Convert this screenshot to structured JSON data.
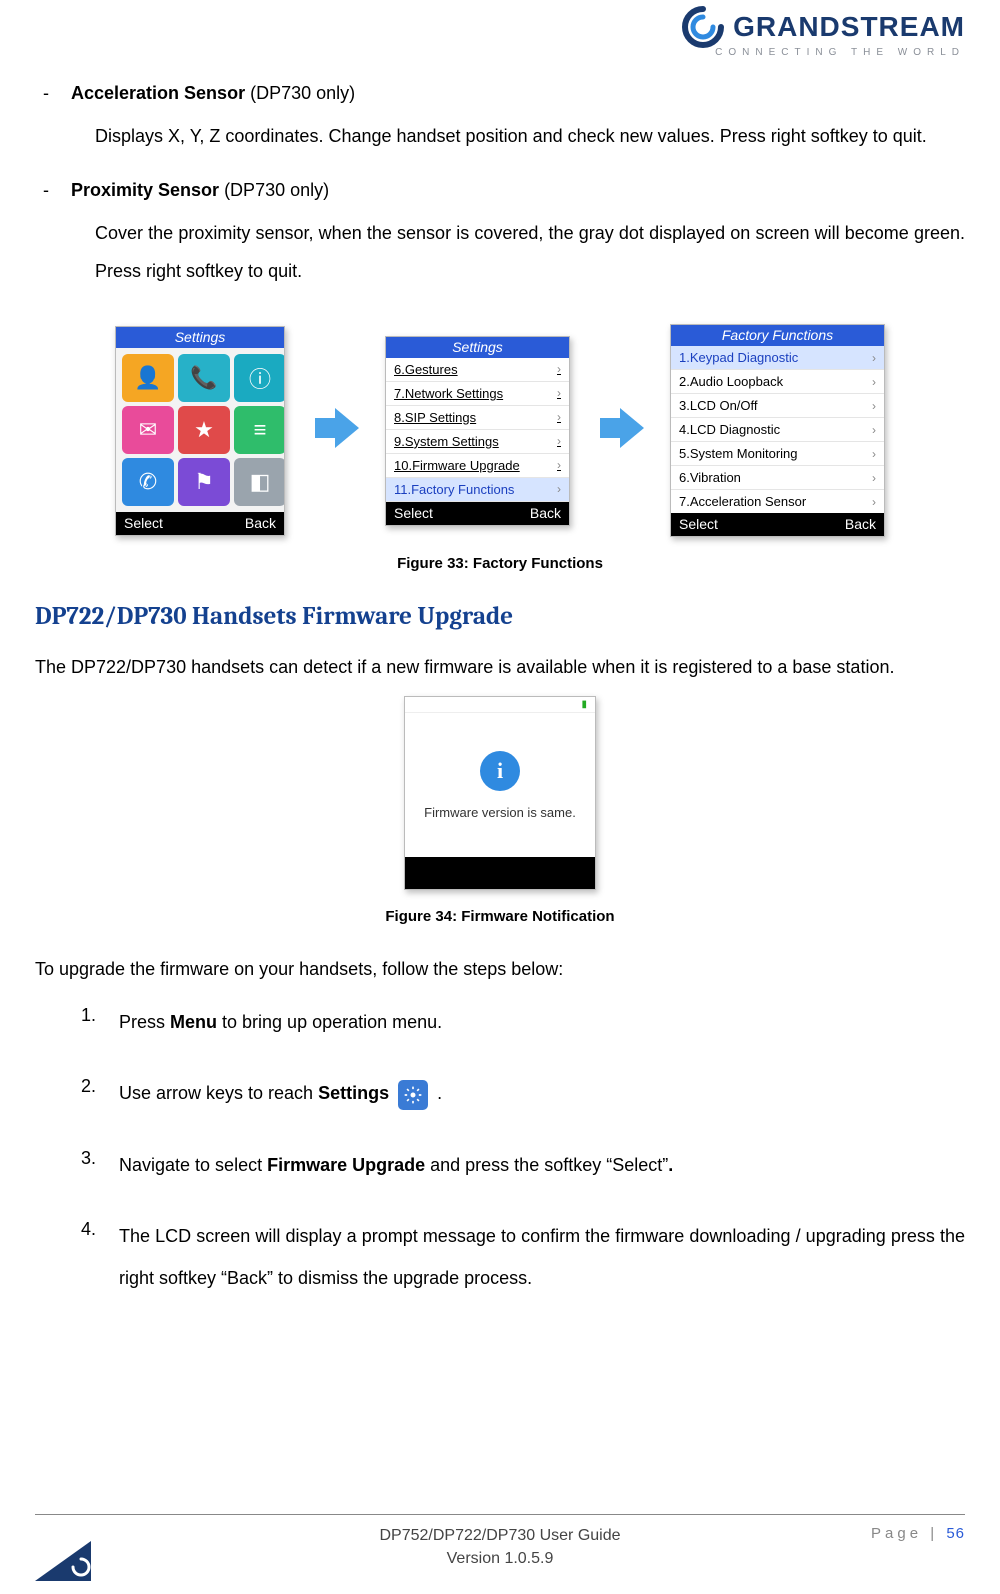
{
  "logo": {
    "brand": "GRANDSTREAM",
    "tagline": "CONNECTING THE WORLD"
  },
  "items": [
    {
      "title": "Acceleration Sensor",
      "note": " (DP730 only)",
      "body": "Displays X, Y, Z coordinates. Change handset position and check new values. Press right softkey to quit."
    },
    {
      "title": "Proximity Sensor",
      "note": " (DP730 only)",
      "body": "Cover the proximity sensor, when the sensor is covered, the gray dot displayed on screen will become green. Press right softkey to quit."
    }
  ],
  "screens": {
    "settingsIcons": {
      "title": "Settings",
      "softLeft": "Select",
      "softRight": "Back"
    },
    "settingsList": {
      "title": "Settings",
      "items": [
        "6.Gestures",
        "7.Network Settings",
        "8.SIP Settings",
        "9.System Settings",
        "10.Firmware Upgrade",
        "11.Factory Functions"
      ],
      "selectedIndex": 5,
      "softLeft": "Select",
      "softRight": "Back"
    },
    "factoryFunctions": {
      "title": "Factory Functions",
      "items": [
        "1.Keypad Diagnostic",
        "2.Audio Loopback",
        "3.LCD On/Off",
        "4.LCD Diagnostic",
        "5.System Monitoring",
        "6.Vibration",
        "7.Acceleration Sensor"
      ],
      "selectedIndex": 0,
      "softLeft": "Select",
      "softRight": "Back"
    }
  },
  "figure33": "Figure 33: Factory Functions",
  "sectionHeading": "DP722/DP730 Handsets Firmware Upgrade",
  "sectionIntro": "The DP722/DP730 handsets can detect if a new firmware is available when it is registered to a base station.",
  "notification": {
    "message": "Firmware version is same."
  },
  "figure34": "Figure 34: Firmware Notification",
  "stepsIntro": "To upgrade the firmware on your handsets, follow the steps below:",
  "steps": {
    "s1a": "Press ",
    "s1b": "Menu",
    "s1c": " to bring up operation menu.",
    "s2a": "Use arrow keys to reach ",
    "s2b": "Settings",
    "s2c": " .",
    "s3a": "Navigate to select ",
    "s3b": "Firmware Upgrade",
    "s3c": " and press the softkey “Select”",
    "s3d": ".",
    "s4": "The LCD screen will display a prompt message to confirm the firmware downloading / upgrading press the right softkey “Back” to dismiss the upgrade process."
  },
  "footer": {
    "line1": "DP752/DP722/DP730 User Guide",
    "line2": "Version 1.0.5.9",
    "pageLabel": "Page | ",
    "pageNum": "56"
  }
}
